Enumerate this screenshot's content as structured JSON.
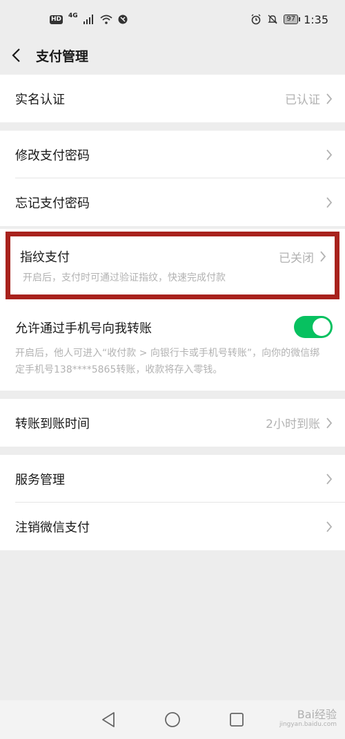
{
  "status_bar": {
    "hd": "HD",
    "network": "4G",
    "battery": "97",
    "time": "1:35",
    "icons": [
      "signal-icon",
      "wifi-icon",
      "vpn-icon",
      "alarm-icon",
      "mute-icon",
      "battery-icon"
    ]
  },
  "header": {
    "title": "支付管理",
    "back_icon": "chevron-left-icon"
  },
  "sections": {
    "realname": {
      "label": "实名认证",
      "value": "已认证"
    },
    "change_password": {
      "label": "修改支付密码"
    },
    "forgot_password": {
      "label": "忘记支付密码"
    },
    "fingerprint": {
      "label": "指纹支付",
      "value": "已关闭",
      "description": "开启后，支付时可通过验证指纹，快速完成付款"
    },
    "phone_transfer": {
      "label": "允许通过手机号向我转账",
      "enabled": true,
      "description": "开启后，他人可进入“收付款 > 向银行卡或手机号转账”，向你的微信绑定手机号138****5865转账，收款将存入零钱。"
    },
    "arrival_time": {
      "label": "转账到账时间",
      "value": "2小时到账"
    },
    "service_manage": {
      "label": "服务管理"
    },
    "cancel_pay": {
      "label": "注销微信支付"
    }
  },
  "colors": {
    "accent_green": "#07c160",
    "highlight_red": "#a8221d",
    "muted_text": "#b2b2b2",
    "background": "#ededed"
  },
  "nav_bar": {
    "icons": [
      "back-triangle-icon",
      "home-circle-icon",
      "recents-square-icon"
    ]
  },
  "watermark": {
    "text": "Bai经验",
    "sub": "jingyan.baidu.com"
  }
}
